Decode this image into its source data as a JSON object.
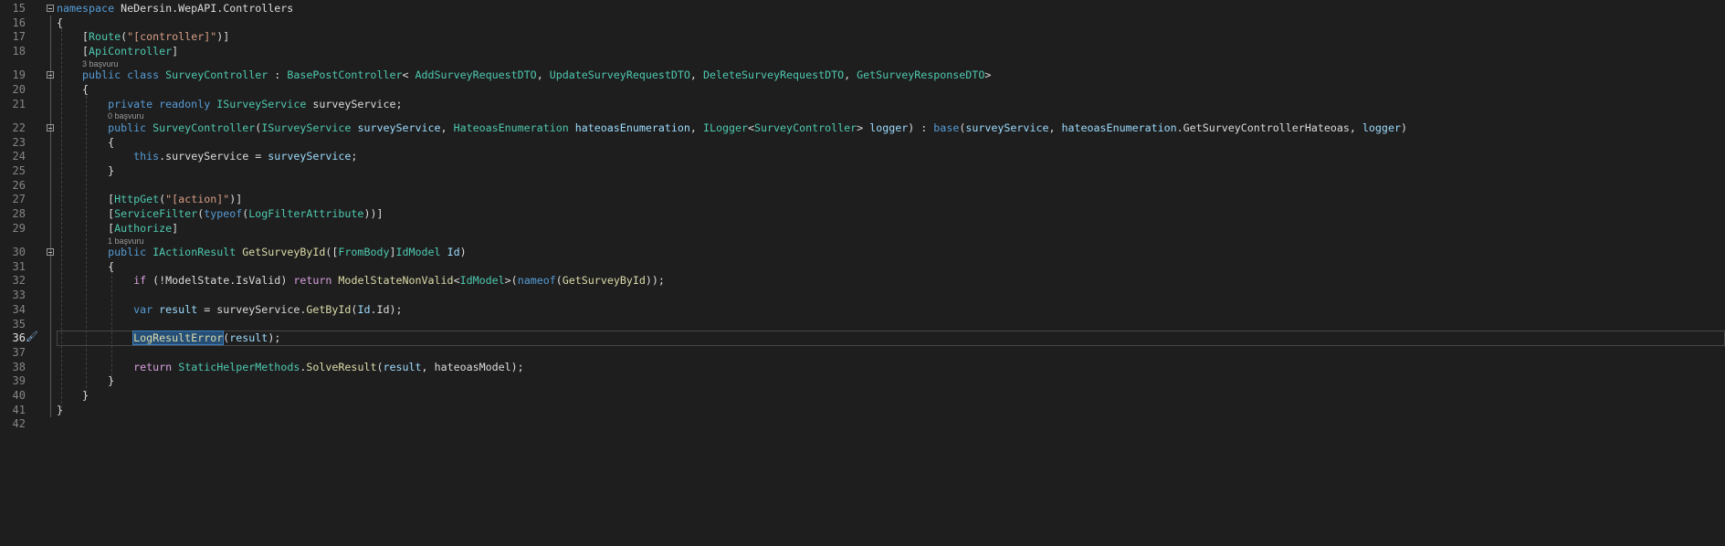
{
  "editor": {
    "current_line": 36,
    "lines": [
      {
        "n": 15,
        "fold": true,
        "t": [
          [
            "kw",
            "namespace"
          ],
          [
            "plain",
            " NeDersin.WepAPI.Controllers"
          ]
        ]
      },
      {
        "n": 16,
        "t": [
          [
            "plain",
            "{"
          ]
        ]
      },
      {
        "n": 17,
        "t": [
          [
            "plain",
            "    ["
          ],
          [
            "type",
            "Route"
          ],
          [
            "plain",
            "("
          ],
          [
            "str",
            "\"[controller]\""
          ],
          [
            "plain",
            ")]"
          ]
        ]
      },
      {
        "n": 18,
        "t": [
          [
            "plain",
            "    ["
          ],
          [
            "type",
            "ApiController"
          ],
          [
            "plain",
            "]"
          ]
        ]
      },
      {
        "lens": "3 başvuru",
        "indent": 4
      },
      {
        "n": 19,
        "fold": true,
        "t": [
          [
            "plain",
            "    "
          ],
          [
            "kw",
            "public class "
          ],
          [
            "type",
            "SurveyController"
          ],
          [
            "plain",
            " : "
          ],
          [
            "type",
            "BasePostController"
          ],
          [
            "plain",
            "< "
          ],
          [
            "type",
            "AddSurveyRequestDTO"
          ],
          [
            "plain",
            ", "
          ],
          [
            "type",
            "UpdateSurveyRequestDTO"
          ],
          [
            "plain",
            ", "
          ],
          [
            "type",
            "DeleteSurveyRequestDTO"
          ],
          [
            "plain",
            ", "
          ],
          [
            "type",
            "GetSurveyResponseDTO"
          ],
          [
            "plain",
            ">"
          ]
        ]
      },
      {
        "n": 20,
        "t": [
          [
            "plain",
            "    {"
          ]
        ]
      },
      {
        "n": 21,
        "t": [
          [
            "plain",
            "        "
          ],
          [
            "kw",
            "private readonly "
          ],
          [
            "type",
            "ISurveyService"
          ],
          [
            "plain",
            " surveyService;"
          ]
        ]
      },
      {
        "lens": "0 başvuru",
        "indent": 8
      },
      {
        "n": 22,
        "fold": true,
        "t": [
          [
            "plain",
            "        "
          ],
          [
            "kw",
            "public "
          ],
          [
            "type",
            "SurveyController"
          ],
          [
            "plain",
            "("
          ],
          [
            "type",
            "ISurveyService"
          ],
          [
            "plain",
            " "
          ],
          [
            "param",
            "surveyService"
          ],
          [
            "plain",
            ", "
          ],
          [
            "type",
            "HateoasEnumeration"
          ],
          [
            "plain",
            " "
          ],
          [
            "param",
            "hateoasEnumeration"
          ],
          [
            "plain",
            ", "
          ],
          [
            "type",
            "ILogger"
          ],
          [
            "plain",
            "<"
          ],
          [
            "type",
            "SurveyController"
          ],
          [
            "plain",
            "> "
          ],
          [
            "param",
            "logger"
          ],
          [
            "plain",
            ") : "
          ],
          [
            "kw",
            "base"
          ],
          [
            "plain",
            "("
          ],
          [
            "param",
            "surveyService"
          ],
          [
            "plain",
            ", "
          ],
          [
            "param",
            "hateoasEnumeration"
          ],
          [
            "plain",
            ".GetSurveyControllerHateoas, "
          ],
          [
            "param",
            "logger"
          ],
          [
            "plain",
            ")"
          ]
        ]
      },
      {
        "n": 23,
        "t": [
          [
            "plain",
            "        {"
          ]
        ]
      },
      {
        "n": 24,
        "t": [
          [
            "plain",
            "            "
          ],
          [
            "kw",
            "this"
          ],
          [
            "plain",
            ".surveyService = "
          ],
          [
            "param",
            "surveyService"
          ],
          [
            "plain",
            ";"
          ]
        ]
      },
      {
        "n": 25,
        "t": [
          [
            "plain",
            "        }"
          ]
        ]
      },
      {
        "n": 26,
        "t": []
      },
      {
        "n": 27,
        "t": [
          [
            "plain",
            "        ["
          ],
          [
            "type",
            "HttpGet"
          ],
          [
            "plain",
            "("
          ],
          [
            "str",
            "\"[action]\""
          ],
          [
            "plain",
            ")]"
          ]
        ]
      },
      {
        "n": 28,
        "t": [
          [
            "plain",
            "        ["
          ],
          [
            "type",
            "ServiceFilter"
          ],
          [
            "plain",
            "("
          ],
          [
            "kw",
            "typeof"
          ],
          [
            "plain",
            "("
          ],
          [
            "type",
            "LogFilterAttribute"
          ],
          [
            "plain",
            "))]"
          ]
        ]
      },
      {
        "n": 29,
        "t": [
          [
            "plain",
            "        ["
          ],
          [
            "type",
            "Authorize"
          ],
          [
            "plain",
            "]"
          ]
        ]
      },
      {
        "lens": "1 başvuru",
        "indent": 8
      },
      {
        "n": 30,
        "fold": true,
        "t": [
          [
            "plain",
            "        "
          ],
          [
            "kw",
            "public "
          ],
          [
            "type",
            "IActionResult"
          ],
          [
            "plain",
            " "
          ],
          [
            "method",
            "GetSurveyById"
          ],
          [
            "plain",
            "(["
          ],
          [
            "type",
            "FromBody"
          ],
          [
            "plain",
            "]"
          ],
          [
            "type",
            "IdModel"
          ],
          [
            "plain",
            " "
          ],
          [
            "param",
            "Id"
          ],
          [
            "plain",
            ")"
          ]
        ]
      },
      {
        "n": 31,
        "t": [
          [
            "plain",
            "        {"
          ]
        ]
      },
      {
        "n": 32,
        "t": [
          [
            "plain",
            "            "
          ],
          [
            "ctrl",
            "if"
          ],
          [
            "plain",
            " (!ModelState.IsValid) "
          ],
          [
            "ctrl",
            "return"
          ],
          [
            "plain",
            " "
          ],
          [
            "method",
            "ModelStateNonValid"
          ],
          [
            "plain",
            "<"
          ],
          [
            "type",
            "IdModel"
          ],
          [
            "plain",
            ">("
          ],
          [
            "kw",
            "nameof"
          ],
          [
            "plain",
            "("
          ],
          [
            "method",
            "GetSurveyById"
          ],
          [
            "plain",
            "));"
          ]
        ]
      },
      {
        "n": 33,
        "t": []
      },
      {
        "n": 34,
        "t": [
          [
            "plain",
            "            "
          ],
          [
            "kw",
            "var"
          ],
          [
            "plain",
            " "
          ],
          [
            "param",
            "result"
          ],
          [
            "plain",
            " = surveyService."
          ],
          [
            "method",
            "GetById"
          ],
          [
            "plain",
            "("
          ],
          [
            "param",
            "Id"
          ],
          [
            "plain",
            ".Id);"
          ]
        ]
      },
      {
        "n": 35,
        "t": []
      },
      {
        "n": 36,
        "t": [
          [
            "plain",
            "            "
          ],
          [
            "method sel",
            "LogResultError"
          ],
          [
            "plain",
            "("
          ],
          [
            "param",
            "result"
          ],
          [
            "plain",
            ");"
          ]
        ]
      },
      {
        "n": 37,
        "t": []
      },
      {
        "n": 38,
        "t": [
          [
            "plain",
            "            "
          ],
          [
            "ctrl",
            "return"
          ],
          [
            "plain",
            " "
          ],
          [
            "type",
            "StaticHelperMethods"
          ],
          [
            "plain",
            "."
          ],
          [
            "method",
            "SolveResult"
          ],
          [
            "plain",
            "("
          ],
          [
            "param",
            "result"
          ],
          [
            "plain",
            ", hateoasModel);"
          ]
        ]
      },
      {
        "n": 39,
        "t": [
          [
            "plain",
            "        }"
          ]
        ]
      },
      {
        "n": 40,
        "t": [
          [
            "plain",
            "    }"
          ]
        ]
      },
      {
        "n": 41,
        "t": [
          [
            "plain",
            "}"
          ]
        ]
      },
      {
        "n": 42,
        "t": []
      }
    ]
  }
}
